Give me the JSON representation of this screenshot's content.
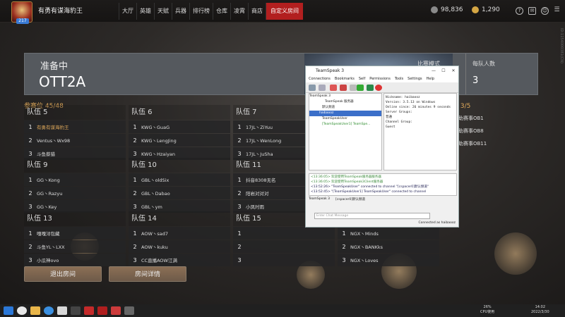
{
  "topbar": {
    "level": "217",
    "player_name": "有勇有谋海豹王",
    "nav": [
      "大厅",
      "英雄",
      "天赋",
      "兵器",
      "排行榜",
      "仓库",
      "凌霄",
      "商店",
      "自定义房间"
    ],
    "active_nav": "自定义房间",
    "coins": "98,836",
    "gold": "1,290",
    "colors": {
      "accent": "#b21f1f",
      "gold_text": "#e0a95a"
    },
    "side_id": "ID:1154000381(CN)"
  },
  "room": {
    "status": "准备中",
    "code": "OTT2A",
    "mode_label": "比赛模式",
    "per_team_label": "每队人数",
    "per_team_value": "3"
  },
  "slots_label": "参赛位 45/48",
  "teams": [
    {
      "name": "队伍 5",
      "players": [
        "有勇有谋海豹王",
        "Ventus丶Wx98",
        "斗鱼蔡猎"
      ],
      "highlight": 0
    },
    {
      "name": "队伍 6",
      "players": [
        "KWG丶GuaG",
        "KWG丶LengJing",
        "KWG丶Hzaiyan"
      ]
    },
    {
      "name": "队伍 7",
      "players": [
        "17JL丶ZiYuu",
        "17JL丶WenLong",
        "17JL丶JuSha"
      ]
    },
    {
      "name": "队伍 9",
      "players": [
        "GG丶Kong",
        "GG丶Razyu",
        "GG丶Key"
      ]
    },
    {
      "name": "队伍 10",
      "players": [
        "GBL丶oldSix",
        "GBL丶Dabao",
        "GBL丶ym"
      ]
    },
    {
      "name": "队伍 11",
      "players": [
        "抖音8308无名",
        "阳岩对对对",
        "小凤时雨"
      ]
    },
    {
      "name": "队伍 13",
      "players": [
        "嘎嘎浔包藏",
        "斗鱼YL丶LXX",
        "小瓜神ovo"
      ]
    },
    {
      "name": "队伍 14",
      "players": [
        "AOW丶sad7",
        "AOW丶kuku",
        "CC直播AOW江满"
      ]
    },
    {
      "name": "队伍 15",
      "players": [
        "",
        "",
        ""
      ]
    },
    {
      "name": "",
      "players": [
        "NGX丶Minds",
        "NGX丶BANKks",
        "NGX丶Loves"
      ]
    }
  ],
  "observers": {
    "header": "观战位 3/5",
    "items": [
      "赤助赛事OB1",
      "赤助赛事OB8",
      "赤助赛事OB11"
    ]
  },
  "buttons": {
    "leave": "退出房间",
    "details": "房间详情"
  },
  "teamspeak": {
    "title": "TeamSpeak 3",
    "menu": [
      "Connections",
      "Bookmarks",
      "Self",
      "Permissions",
      "Tools",
      "Settings",
      "Help"
    ],
    "tree": [
      "TeamSpeak 3",
      "TeamSpeak 服务器",
      "默认频道",
      "haibaooz",
      "TeamSpeakUser",
      "[TeamSpeakUser1] TeamSpe..."
    ],
    "info": [
      "Nickname:     haibaooz",
      "Version: 3.5.13 on Windows",
      "Online since: 26 minutes 9 seconds",
      "Server Groups:",
      "  普通",
      "Channel Group:",
      "  Guest"
    ],
    "chat": [
      "<13:36:05> 欢迎使用TeamSpeak服务器服务器",
      "<13:36:05> 欢迎使用TeamSpeak3Client服务器",
      "<13:52:26> \"TeamSpeakUser\" connected to channel \"[cspacer0]默认频道\"",
      "<13:52:45> \"[TeamSpeakUser1] TeamSpeakUser\" connected to channel",
      "\"[cspacer0]默认频道\""
    ],
    "tabs": [
      "TeamSpeak 3",
      "[cspacer0]默认频道"
    ],
    "input_placeholder": "Enter Chat Message",
    "status": "Connected as haibaooz"
  },
  "taskbar": {
    "perf": "26%",
    "perf_label": "CPU使用",
    "time": "14:02",
    "date": "2022/3/30"
  }
}
